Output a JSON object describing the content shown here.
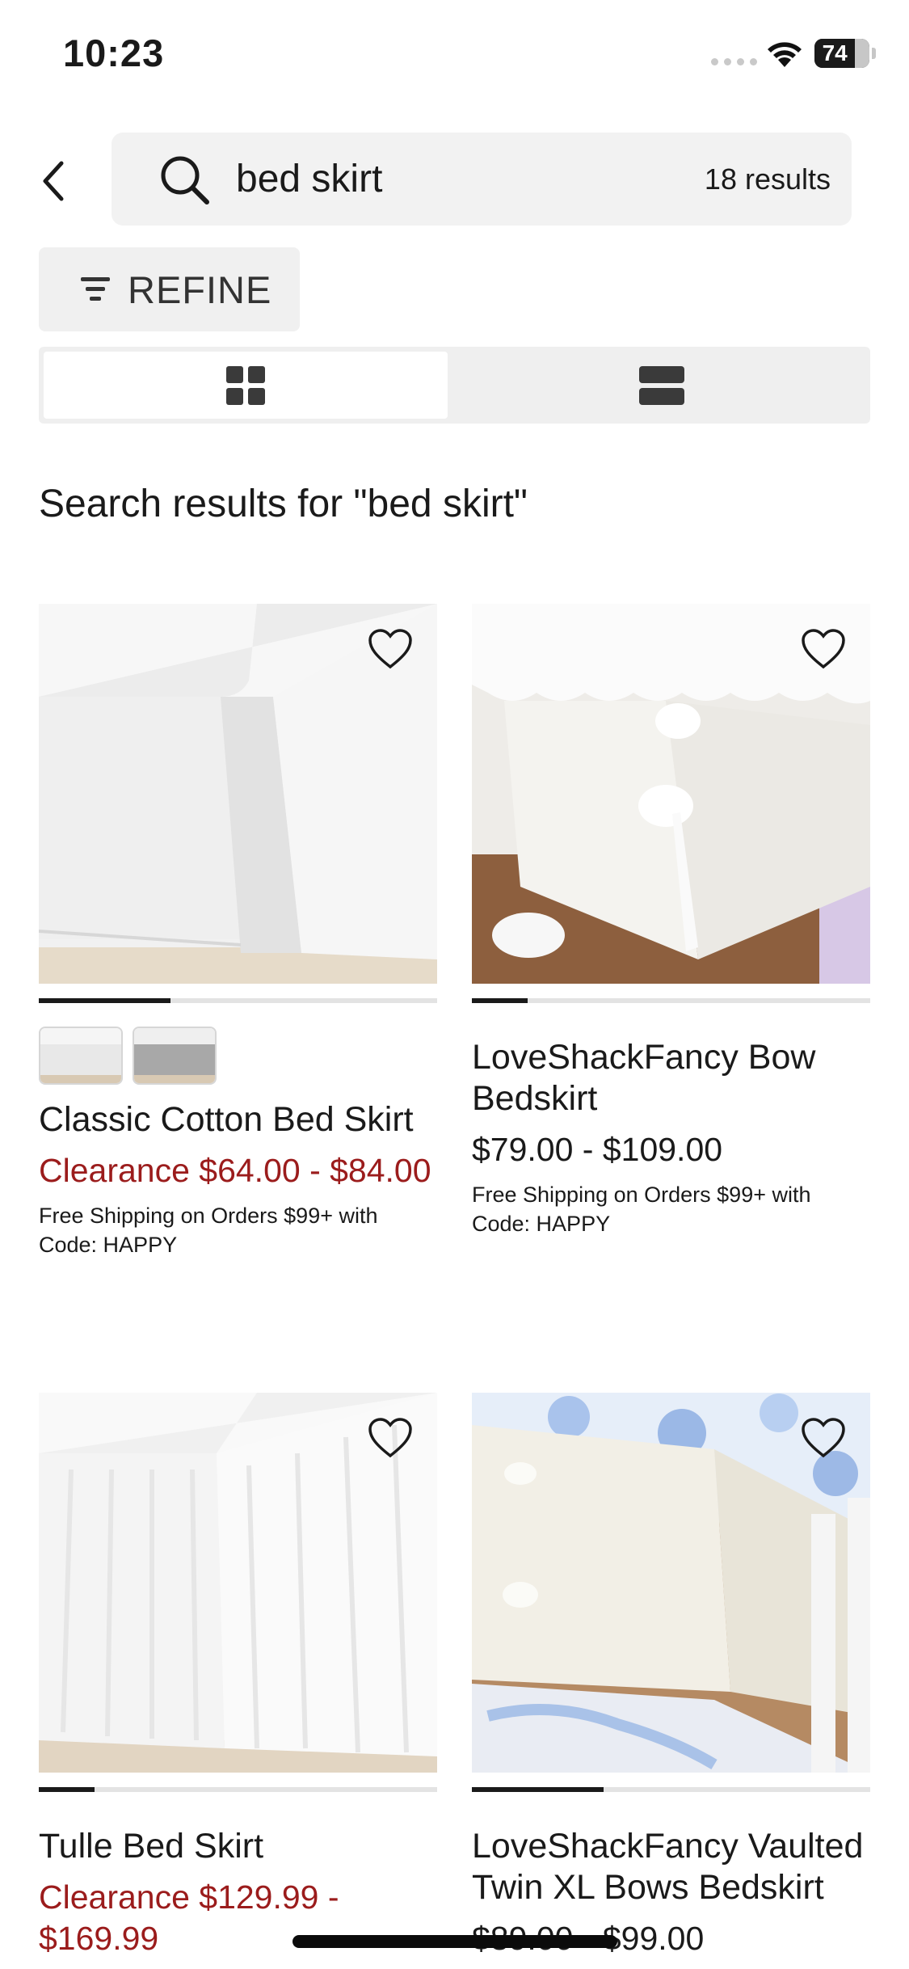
{
  "status_bar": {
    "time": "10:23",
    "battery": "74"
  },
  "search": {
    "query": "bed skirt",
    "results_count": "18 results"
  },
  "refine": {
    "label": "REFINE"
  },
  "view_toggle": {
    "options": [
      "grid-view",
      "list-view"
    ],
    "selected": "grid-view"
  },
  "heading": "Search results for \"bed skirt\"",
  "colors": {
    "sale_red": "#9b1c1c",
    "text": "#1a1a1a",
    "field_bg": "#f2f2f2"
  },
  "products": [
    {
      "name": "Classic Cotton Bed Skirt",
      "price": "Clearance $64.00 - $84.00",
      "price_is_sale": true,
      "shipping": "Free Shipping on Orders $99+ with Code: HAPPY",
      "image_progress": 0.33,
      "swatches": [
        "white",
        "gray"
      ]
    },
    {
      "name": "LoveShackFancy Bow Bedskirt",
      "price": "$79.00 - $109.00",
      "price_is_sale": false,
      "shipping": "Free Shipping on Orders $99+ with Code: HAPPY",
      "image_progress": 0.14
    },
    {
      "name": "Tulle Bed Skirt",
      "price": "Clearance $129.99 - $169.99",
      "price_is_sale": true,
      "image_progress": 0.14
    },
    {
      "name": "LoveShackFancy Vaulted Twin XL Bows Bedskirt",
      "price_original": "$89.00",
      "price": "$99.00",
      "price_is_sale": false,
      "image_progress": 0.33
    }
  ]
}
